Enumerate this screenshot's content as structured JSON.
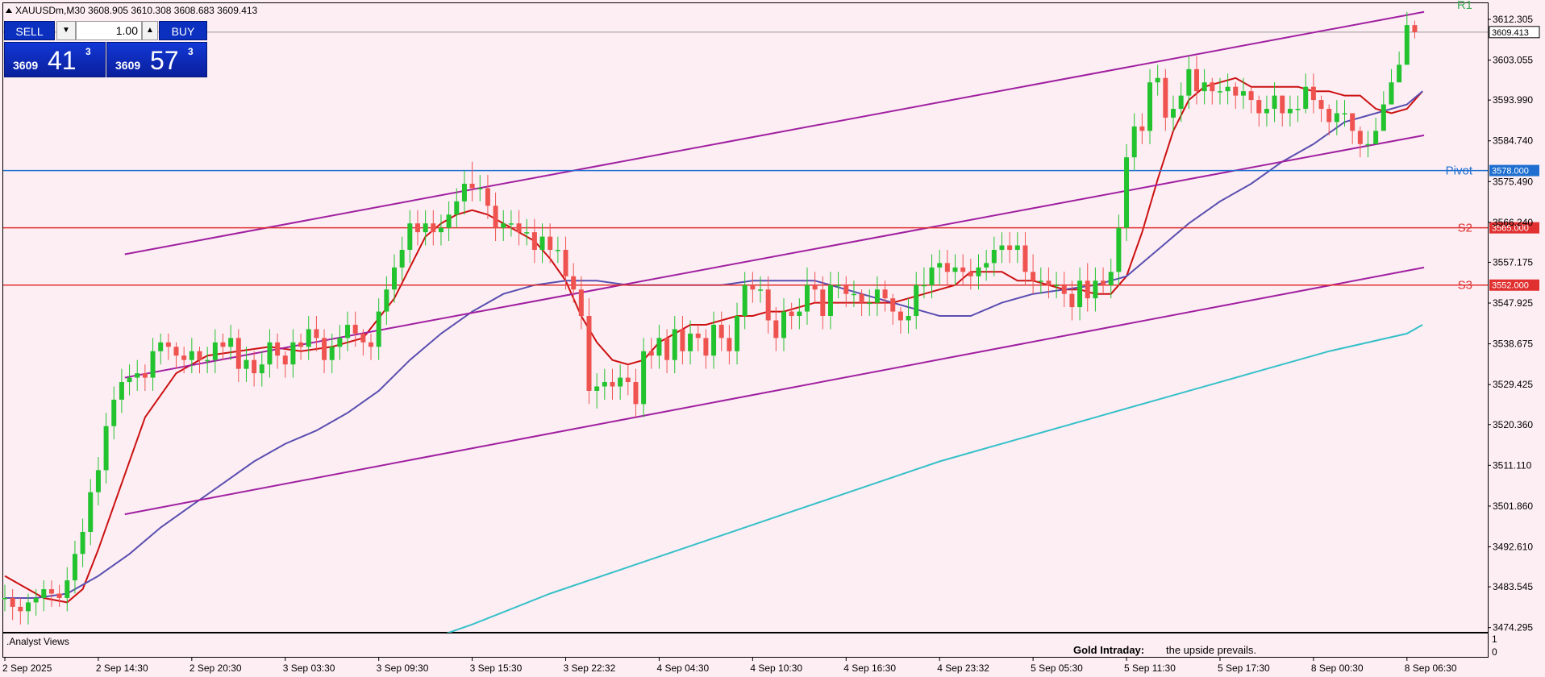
{
  "symbol_header": "XAUUSDm,M30  3608.905 3610.308 3608.683 3609.413",
  "trade_panel": {
    "sell_label": "SELL",
    "buy_label": "BUY",
    "volume": "1.00",
    "bid": {
      "prefix": "3609",
      "big": "41",
      "sup": "3"
    },
    "ask": {
      "prefix": "3609",
      "big": "57",
      "sup": "3"
    }
  },
  "indicator_label": ".Analyst Views",
  "indicator_axis": [
    "1",
    "0"
  ],
  "gold_label": "Gold Intraday:",
  "gold_text": "the upside prevails.",
  "colors": {
    "background": "#fdeef4",
    "bull_candle": "#22c32e",
    "bear_candle": "#ef5350",
    "channel": "#a020a0",
    "pivot": "#1e6fd0",
    "support": "#e03030",
    "ema_fast": "#cc1111",
    "ma_mid": "#5a4fb0",
    "ma_slow": "#36c0c8"
  },
  "chart_data": {
    "type": "candlestick",
    "symbol": "XAUUSDm",
    "timeframe": "M30",
    "y_ticks": [
      3612.305,
      3603.055,
      3593.99,
      3584.74,
      3575.49,
      3566.24,
      3557.175,
      3547.925,
      3538.675,
      3529.425,
      3520.36,
      3511.11,
      3501.86,
      3492.61,
      3483.545,
      3474.295
    ],
    "ylim": [
      3470.7,
      3617.6
    ],
    "x_labels": [
      "2 Sep 2025",
      "2 Sep 14:30",
      "2 Sep 20:30",
      "3 Sep 03:30",
      "3 Sep 09:30",
      "3 Sep 15:30",
      "3 Sep 22:32",
      "4 Sep 04:30",
      "4 Sep 10:30",
      "4 Sep 16:30",
      "4 Sep 23:32",
      "5 Sep 05:30",
      "5 Sep 11:30",
      "5 Sep 17:30",
      "8 Sep 00:30",
      "8 Sep 06:30"
    ],
    "x_label_bars": [
      0,
      12,
      24,
      36,
      48,
      60,
      72,
      84,
      96,
      108,
      120,
      132,
      144,
      156,
      168,
      180
    ],
    "current_price": 3609.413,
    "levels": [
      {
        "label": "Pivot",
        "value": 3578.0,
        "tag": "3578.000",
        "color": "#1e6fd0"
      },
      {
        "label": "S2",
        "value": 3565.0,
        "tag": "3565.000",
        "color": "#e03030"
      },
      {
        "label": "S3",
        "value": 3552.0,
        "tag": "3552.000",
        "color": "#e03030"
      }
    ],
    "r1_label": "R1",
    "channel_lines": [
      {
        "x": [
          15.4,
          182.2
        ],
        "y": [
          3559,
          3614
        ]
      },
      {
        "x": [
          15.4,
          182.2
        ],
        "y": [
          3531,
          3586
        ]
      },
      {
        "x": [
          15.4,
          182.2
        ],
        "y": [
          3500,
          3556
        ]
      }
    ],
    "candles": {
      "open": [
        3481,
        3481,
        3479,
        3478,
        3480,
        3481,
        3483,
        3482,
        3481,
        3485,
        3491,
        3496,
        3505,
        3510,
        3520,
        3526,
        3530,
        3531,
        3532,
        3531,
        3537,
        3539,
        3538,
        3536,
        3535,
        3537,
        3535,
        3535,
        3539,
        3538,
        3540,
        3533,
        3535,
        3532,
        3534,
        3539,
        3536,
        3534,
        3539,
        3538,
        3542,
        3540,
        3535,
        3538,
        3540,
        3543,
        3541,
        3539,
        3538,
        3546,
        3551,
        3556,
        3560,
        3566,
        3564,
        3566,
        3564,
        3565,
        3568,
        3571,
        3575,
        3574,
        3574,
        3570,
        3565,
        3566,
        3566,
        3564,
        3564,
        3560,
        3563,
        3560,
        3560,
        3554,
        3551,
        3545,
        3528,
        3529,
        3530,
        3529,
        3531,
        3530,
        3525,
        3537,
        3536,
        3540,
        3535,
        3542,
        3537,
        3541,
        3540,
        3536,
        3543,
        3540,
        3537,
        3545,
        3552,
        3551,
        3551,
        3544,
        3540,
        3546,
        3545,
        3546,
        3552,
        3551,
        3545,
        3552,
        3552,
        3550,
        3550,
        3548,
        3548,
        3551,
        3549,
        3546,
        3544,
        3545,
        3552,
        3552,
        3556,
        3557,
        3555,
        3556,
        3555,
        3554,
        3556,
        3557,
        3560,
        3561,
        3560,
        3561,
        3555,
        3553,
        3553,
        3552,
        3552,
        3550,
        3547,
        3553,
        3549,
        3553,
        3552,
        3555,
        3565,
        3581,
        3588,
        3587,
        3598,
        3599,
        3590,
        3592,
        3595,
        3601,
        3596,
        3598,
        3596,
        3596,
        3597,
        3595,
        3596,
        3594,
        3591,
        3592,
        3595,
        3591,
        3592,
        3592,
        3597,
        3594,
        3592,
        3589,
        3591,
        3591,
        3587,
        3584,
        3584,
        3587,
        3593,
        3598,
        3602,
        3611
      ],
      "close": [
        3481,
        3479,
        3478,
        3480,
        3481,
        3483,
        3482,
        3481,
        3485,
        3491,
        3496,
        3505,
        3510,
        3520,
        3526,
        3530,
        3531,
        3532,
        3531,
        3537,
        3539,
        3538,
        3536,
        3535,
        3537,
        3535,
        3535,
        3539,
        3538,
        3540,
        3533,
        3535,
        3532,
        3534,
        3539,
        3536,
        3534,
        3539,
        3538,
        3542,
        3540,
        3535,
        3538,
        3540,
        3543,
        3541,
        3539,
        3538,
        3546,
        3551,
        3556,
        3560,
        3566,
        3564,
        3566,
        3564,
        3565,
        3568,
        3571,
        3575,
        3574,
        3574,
        3570,
        3565,
        3566,
        3566,
        3564,
        3564,
        3560,
        3563,
        3560,
        3560,
        3554,
        3551,
        3545,
        3528,
        3529,
        3530,
        3529,
        3531,
        3530,
        3525,
        3537,
        3536,
        3540,
        3535,
        3542,
        3537,
        3541,
        3540,
        3536,
        3543,
        3540,
        3537,
        3545,
        3552,
        3551,
        3551,
        3544,
        3540,
        3546,
        3545,
        3546,
        3552,
        3551,
        3545,
        3552,
        3552,
        3550,
        3550,
        3548,
        3548,
        3551,
        3549,
        3546,
        3544,
        3545,
        3552,
        3552,
        3556,
        3557,
        3555,
        3556,
        3555,
        3554,
        3556,
        3557,
        3560,
        3561,
        3560,
        3561,
        3555,
        3553,
        3553,
        3552,
        3552,
        3550,
        3547,
        3553,
        3549,
        3553,
        3552,
        3555,
        3565,
        3581,
        3588,
        3587,
        3598,
        3599,
        3590,
        3592,
        3595,
        3601,
        3596,
        3598,
        3596,
        3596,
        3597,
        3595,
        3596,
        3594,
        3591,
        3592,
        3595,
        3591,
        3592,
        3592,
        3597,
        3594,
        3592,
        3589,
        3591,
        3591,
        3587,
        3584,
        3584,
        3587,
        3593,
        3598,
        3602,
        3611,
        3609.4
      ],
      "high": [
        3484,
        3483,
        3481,
        3482,
        3483,
        3485,
        3485,
        3484,
        3488,
        3494,
        3499,
        3508,
        3513,
        3523,
        3529,
        3533,
        3534,
        3535,
        3534,
        3540,
        3541,
        3541,
        3539,
        3538,
        3540,
        3538,
        3538,
        3542,
        3541,
        3543,
        3542,
        3538,
        3537,
        3537,
        3542,
        3541,
        3537,
        3542,
        3541,
        3545,
        3545,
        3542,
        3541,
        3543,
        3546,
        3546,
        3542,
        3541,
        3549,
        3554,
        3559,
        3563,
        3569,
        3569,
        3569,
        3569,
        3568,
        3571,
        3574,
        3578,
        3580,
        3577,
        3577,
        3573,
        3569,
        3569,
        3569,
        3567,
        3567,
        3566,
        3566,
        3563,
        3563,
        3557,
        3554,
        3549,
        3532,
        3533,
        3533,
        3534,
        3534,
        3533,
        3540,
        3540,
        3543,
        3542,
        3545,
        3545,
        3544,
        3543,
        3542,
        3546,
        3546,
        3543,
        3548,
        3555,
        3555,
        3554,
        3554,
        3547,
        3549,
        3548,
        3549,
        3556,
        3555,
        3554,
        3555,
        3555,
        3554,
        3553,
        3551,
        3551,
        3554,
        3553,
        3550,
        3547,
        3549,
        3555,
        3556,
        3559,
        3560,
        3560,
        3559,
        3559,
        3558,
        3559,
        3560,
        3563,
        3564,
        3564,
        3564,
        3564,
        3559,
        3556,
        3556,
        3555,
        3555,
        3553,
        3556,
        3557,
        3556,
        3556,
        3558,
        3568,
        3584,
        3591,
        3591,
        3601,
        3602,
        3601,
        3595,
        3598,
        3604,
        3604,
        3601,
        3599,
        3599,
        3600,
        3598,
        3599,
        3597,
        3595,
        3595,
        3598,
        3595,
        3595,
        3595,
        3600,
        3600,
        3595,
        3593,
        3594,
        3594,
        3591,
        3588,
        3587,
        3590,
        3596,
        3601,
        3605,
        3614,
        3612
      ],
      "low": [
        3478,
        3476,
        3475,
        3475,
        3477,
        3478,
        3479,
        3479,
        3478,
        3482,
        3488,
        3493,
        3502,
        3507,
        3517,
        3523,
        3527,
        3528,
        3528,
        3528,
        3534,
        3535,
        3533,
        3532,
        3532,
        3532,
        3532,
        3532,
        3535,
        3535,
        3530,
        3530,
        3529,
        3529,
        3531,
        3533,
        3531,
        3531,
        3535,
        3535,
        3537,
        3532,
        3532,
        3535,
        3537,
        3538,
        3536,
        3535,
        3535,
        3543,
        3548,
        3553,
        3557,
        3561,
        3561,
        3561,
        3561,
        3562,
        3565,
        3568,
        3571,
        3571,
        3567,
        3562,
        3562,
        3563,
        3561,
        3561,
        3557,
        3557,
        3557,
        3557,
        3551,
        3548,
        3542,
        3525,
        3524,
        3526,
        3526,
        3526,
        3527,
        3522,
        3522,
        3533,
        3533,
        3532,
        3532,
        3534,
        3534,
        3537,
        3533,
        3533,
        3537,
        3534,
        3534,
        3542,
        3548,
        3548,
        3541,
        3537,
        3537,
        3542,
        3542,
        3543,
        3548,
        3542,
        3542,
        3549,
        3547,
        3547,
        3545,
        3545,
        3545,
        3546,
        3543,
        3541,
        3541,
        3542,
        3549,
        3549,
        3552,
        3552,
        3552,
        3552,
        3551,
        3551,
        3553,
        3554,
        3557,
        3557,
        3557,
        3552,
        3550,
        3550,
        3549,
        3549,
        3547,
        3544,
        3544,
        3546,
        3546,
        3550,
        3549,
        3552,
        3562,
        3578,
        3584,
        3584,
        3595,
        3587,
        3587,
        3589,
        3592,
        3593,
        3593,
        3593,
        3593,
        3593,
        3592,
        3592,
        3591,
        3588,
        3588,
        3589,
        3588,
        3588,
        3589,
        3591,
        3591,
        3589,
        3586,
        3586,
        3588,
        3584,
        3581,
        3581,
        3584,
        3590,
        3595,
        3599,
        3608,
        3608
      ]
    },
    "moving_averages": [
      {
        "color": "#cc1111",
        "x": [
          0,
          2,
          5,
          8,
          10,
          12,
          15,
          18,
          22,
          26,
          30,
          34,
          38,
          42,
          46,
          50,
          52,
          54,
          56,
          58,
          60,
          62,
          64,
          66,
          68,
          70,
          72,
          74,
          76,
          78,
          80,
          82,
          84,
          86,
          88,
          90,
          92,
          94,
          96,
          98,
          100,
          102,
          104,
          106,
          108,
          110,
          112,
          114,
          116,
          118,
          120,
          122,
          124,
          126,
          128,
          130,
          132,
          134,
          136,
          138,
          140,
          142,
          144,
          146,
          148,
          150,
          152,
          154,
          156,
          158,
          160,
          162,
          164,
          166,
          168,
          170,
          172,
          174,
          176,
          178,
          180,
          182
        ],
        "y": [
          3486,
          3484,
          3481,
          3480,
          3483,
          3492,
          3507,
          3522,
          3532,
          3536,
          3537,
          3538,
          3537,
          3538,
          3540,
          3549,
          3556,
          3563,
          3566,
          3568,
          3569,
          3568,
          3566,
          3564,
          3562,
          3558,
          3553,
          3545,
          3539,
          3535,
          3534,
          3535,
          3539,
          3541,
          3543,
          3543,
          3544,
          3545,
          3545,
          3546,
          3546,
          3547,
          3548,
          3548,
          3548,
          3548,
          3548,
          3548,
          3549,
          3550,
          3551,
          3552,
          3555,
          3555,
          3555,
          3553,
          3553,
          3552,
          3551,
          3551,
          3550,
          3550,
          3554,
          3564,
          3576,
          3587,
          3594,
          3597,
          3598,
          3599,
          3597,
          3597,
          3597,
          3597,
          3596,
          3596,
          3595,
          3595,
          3592,
          3591,
          3592,
          3596
        ]
      },
      {
        "color": "#5a4fb0",
        "x": [
          0,
          4,
          8,
          12,
          16,
          20,
          24,
          28,
          32,
          36,
          40,
          44,
          48,
          52,
          56,
          60,
          64,
          68,
          72,
          76,
          80,
          84,
          88,
          92,
          96,
          100,
          104,
          108,
          112,
          116,
          120,
          124,
          128,
          132,
          136,
          140,
          144,
          148,
          152,
          156,
          160,
          164,
          168,
          172,
          176,
          180,
          182
        ],
        "y": [
          3481,
          3481,
          3482,
          3486,
          3491,
          3497,
          3502,
          3507,
          3512,
          3516,
          3519,
          3523,
          3528,
          3535,
          3541,
          3546,
          3550,
          3552,
          3553,
          3553,
          3552,
          3552,
          3552,
          3552,
          3553,
          3553,
          3553,
          3551,
          3549,
          3547,
          3545,
          3545,
          3548,
          3550,
          3551,
          3552,
          3554,
          3560,
          3566,
          3571,
          3575,
          3580,
          3584,
          3589,
          3591,
          3593,
          3596
        ]
      },
      {
        "color": "#36c0c8",
        "x": [
          53,
          60,
          70,
          80,
          90,
          100,
          110,
          120,
          130,
          140,
          150,
          160,
          170,
          180,
          182
        ],
        "y": [
          3470.7,
          3475,
          3482,
          3488,
          3494,
          3500,
          3506,
          3512,
          3517,
          3522,
          3527,
          3532,
          3537,
          3541,
          3543
        ]
      }
    ]
  }
}
